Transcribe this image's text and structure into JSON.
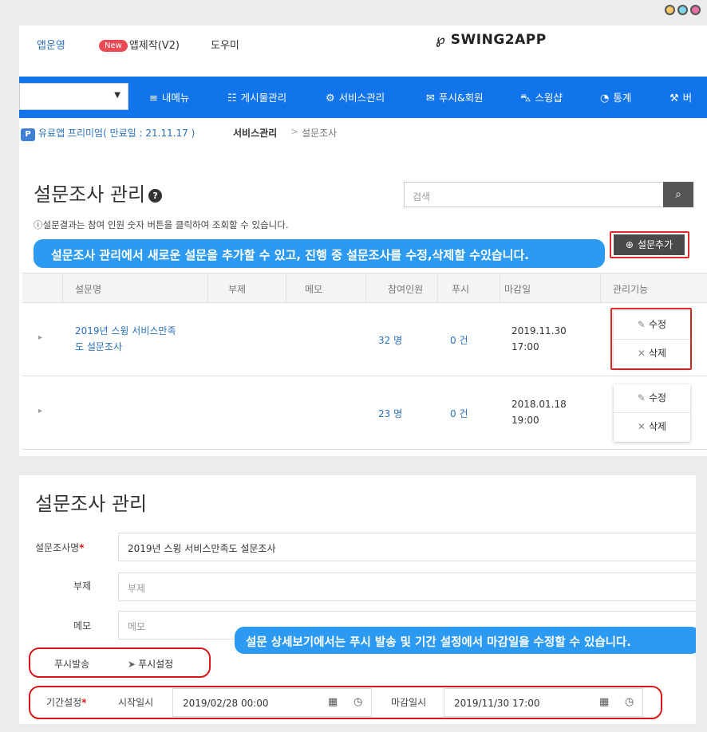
{
  "window": {
    "dot_colors": [
      "#f6c96a",
      "#7fd6e6",
      "#e46fa1"
    ]
  },
  "topbar": {
    "link_manage": "앱운영",
    "new_badge": "New",
    "link_make": "앱제작(V2)",
    "link_help": "도우미",
    "logo_mark": "℘",
    "logo_text": "SWING2APP"
  },
  "navbar": {
    "select_value": "",
    "items": [
      {
        "icon": "menu-icon",
        "glyph": "≡",
        "label": "내메뉴"
      },
      {
        "icon": "document-icon",
        "glyph": "☷",
        "label": "게시물관리"
      },
      {
        "icon": "gear-icon",
        "glyph": "⚙",
        "label": "서비스관리"
      },
      {
        "icon": "mail-icon",
        "glyph": "✉",
        "label": "푸시&회원"
      },
      {
        "icon": "cart-icon",
        "glyph": "⛍",
        "label": "스윙샵"
      },
      {
        "icon": "pie-chart-icon",
        "glyph": "◔",
        "label": "통계"
      },
      {
        "icon": "wrench-icon",
        "glyph": "⚒",
        "label": "버"
      }
    ],
    "accent": "#1274ea"
  },
  "breadcrumb": {
    "plan": "유료앱 프리미엄( 만료일 : 21.11.17 )",
    "section": "서비스관리",
    "sep": ">",
    "page": "설문조사"
  },
  "list": {
    "title": "설문조사 관리",
    "help_glyph": "?",
    "search_placeholder": "검색",
    "search_glyph": "⌕",
    "note": "ⓘ설문결과는 참여 인원 숫자 버튼을 클릭하여 조회할 수 있습니다.",
    "callout": "설문조사 관리에서 새로운 설문을 추가할  수 있고, 진행 중 설문조사를 수정,삭제할 수있습니다.",
    "add_button": "설문추가",
    "add_glyph": "⊕",
    "headers": [
      "설문명",
      "부제",
      "메모",
      "참여인원",
      "푸시",
      "마감일",
      "관리기능"
    ],
    "rows": [
      {
        "title_line1": "2019년 스윙 서비스만족",
        "title_line2": "도 설문조사",
        "subtitle": "",
        "memo": "",
        "participants": "32 명",
        "push": "0 건",
        "deadline_date": "2019.11.30",
        "deadline_time": "17:00",
        "edit": "수정",
        "delete": "삭제"
      },
      {
        "title_line1": "",
        "title_line2": "",
        "subtitle": "",
        "memo": "",
        "participants": "23 명",
        "push": "0 건",
        "deadline_date": "2018.01.18",
        "deadline_time": "19:00",
        "edit": "수정",
        "delete": "삭제"
      }
    ],
    "expand_glyph": "▸",
    "edit_glyph": "✎",
    "delete_glyph": "✕"
  },
  "detail": {
    "title": "설문조사 관리",
    "name_label": "설문조사명",
    "name_value": "2019년 스윙 서비스만족도 설문조사",
    "subtitle_label": "부제",
    "subtitle_placeholder": "부제",
    "memo_label": "메모",
    "memo_placeholder": "메모",
    "callout": "설문 상세보기에서는 푸시 발송 및 기간 설정에서 마감일을 수정할 수 있습니다.",
    "push_label": "푸시발송",
    "push_setting": "푸시설정",
    "push_glyph": "➤",
    "period_label": "기간설정",
    "start_label": "시작일시",
    "start_value": "2019/02/28 00:00",
    "end_label": "마감일시",
    "end_value": "2019/11/30 17:00",
    "required_mark": "*",
    "calendar_glyph": "▦",
    "clock_glyph": "◷"
  },
  "colors": {
    "callout": "#2b9af0",
    "highlight_border": "#e02a2a",
    "link_blue": "#2a6fb8"
  }
}
